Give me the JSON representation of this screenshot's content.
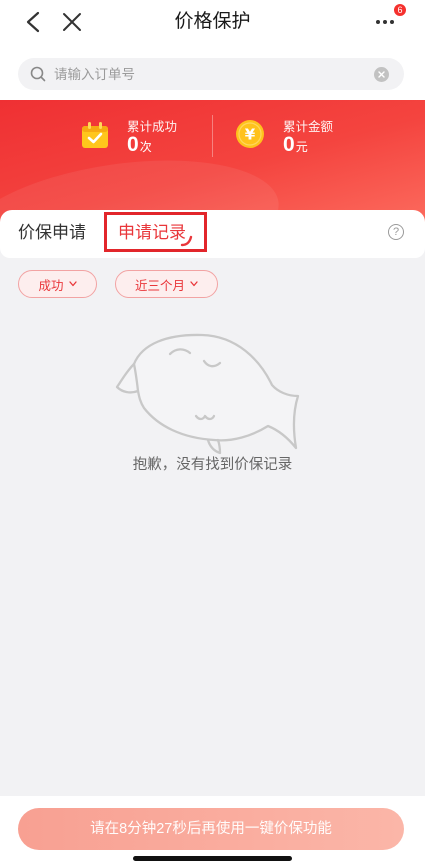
{
  "nav": {
    "back_icon": "chevron-left-icon",
    "close_icon": "close-icon",
    "title": "价格保护",
    "more_icon": "more-dots-icon",
    "more_badge": "6"
  },
  "search": {
    "icon": "search-icon",
    "placeholder": "请输入订单号",
    "clear_icon": "clear-icon"
  },
  "summary": {
    "success": {
      "icon": "calendar-check-icon",
      "label": "累计成功",
      "value": "0",
      "unit": "次"
    },
    "amount": {
      "icon": "yuan-coin-icon",
      "symbol": "¥",
      "label": "累计金额",
      "value": "0",
      "unit": "元"
    }
  },
  "tabs": [
    {
      "label": "价保申请",
      "active": false
    },
    {
      "label": "申请记录",
      "active": true
    }
  ],
  "help": {
    "icon": "help-icon",
    "glyph": "?"
  },
  "filters": [
    {
      "label": "成功",
      "icon": "chevron-down-icon"
    },
    {
      "label": "近三个月",
      "icon": "chevron-down-icon"
    }
  ],
  "empty_state": {
    "illustration": "empty-mascot-illustration",
    "message": "抱歉，没有找到价保记录"
  },
  "footer": {
    "button_label": "请在8分钟27秒后再使用一键价保功能",
    "disabled": true
  },
  "colors": {
    "brand_red": "#e9363a",
    "badge_red": "#f5312e",
    "banner_start": "#ef3033",
    "banner_end": "#fc6a5d",
    "chip_bg": "#fdeeee",
    "chip_border": "#f2a3a3",
    "page_bg": "#f2f2f4",
    "button_start": "#f8a092",
    "button_end": "#fbb6a8",
    "highlight": "#e2262b"
  }
}
